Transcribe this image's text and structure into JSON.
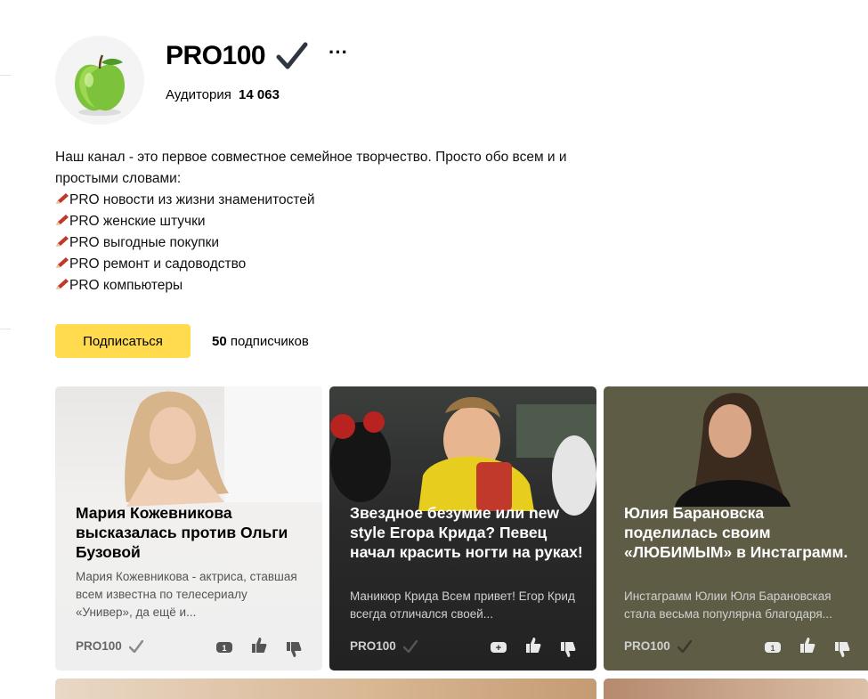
{
  "channel": {
    "name": "PRO100",
    "audience_label": "Аудитория",
    "audience_value": "14 063",
    "more_label": "···"
  },
  "description": {
    "intro": "Наш канал - это первое совместное семейное творчество. Просто обо всем и и простыми словами:",
    "items": [
      "PRO новости из жизни знаменитостей",
      "PRO женские штучки",
      "PRO выгодные покупки",
      "PRO ремонт и садоводство",
      "PRO компьютеры"
    ]
  },
  "subscribe": {
    "button_label": "Подписаться",
    "count": "50",
    "count_label": "подписчиков"
  },
  "cards": [
    {
      "title": "Мария Кожевникова высказалась против Ольги Бузовой",
      "snippet": "Мария Кожевникова - актриса, ставшая всем известна по телесериалу «Универ», да ещё и...",
      "source": "PRO100",
      "comments": "1",
      "theme": "light",
      "bg_color": "#f0efef"
    },
    {
      "title": "Звездное безумие или new style Егора Крида? Певец начал красить ногти на руках!",
      "snippet": "Маникюр Крида Всем привет! Егор Крид всегда отличался своей...",
      "source": "PRO100",
      "comments": "+",
      "theme": "dark",
      "bg_color": "#2b2b2b"
    },
    {
      "title": "Юлия Барановска поделилась своим «ЛЮБИМЫМ» в Инстаграмм.",
      "snippet": "Инстаграмм Юлии Юля Барановская стала весьма популярна благодаря...",
      "source": "PRO100",
      "comments": "1",
      "theme": "dark",
      "bg_color": "#5e5c44"
    }
  ],
  "colors": {
    "accent_yellow": "#ffdb4d",
    "check_dark": "#2f3640"
  }
}
